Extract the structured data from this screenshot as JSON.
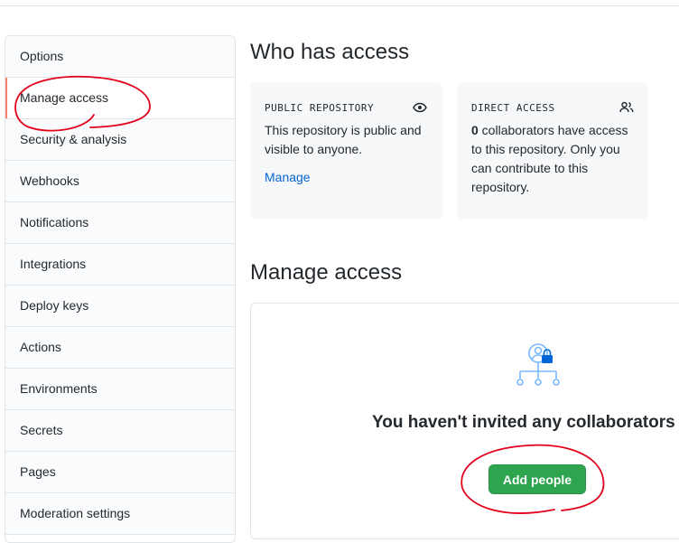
{
  "sidebar": {
    "items": [
      {
        "label": "Options"
      },
      {
        "label": "Manage access",
        "active": true
      },
      {
        "label": "Security & analysis"
      },
      {
        "label": "Webhooks"
      },
      {
        "label": "Notifications"
      },
      {
        "label": "Integrations"
      },
      {
        "label": "Deploy keys"
      },
      {
        "label": "Actions"
      },
      {
        "label": "Environments"
      },
      {
        "label": "Secrets"
      },
      {
        "label": "Pages"
      },
      {
        "label": "Moderation settings"
      }
    ]
  },
  "who_has_access": {
    "title": "Who has access",
    "public_card": {
      "title": "PUBLIC REPOSITORY",
      "icon": "eye-icon",
      "text": "This repository is public and visible to anyone.",
      "link": "Manage"
    },
    "direct_card": {
      "title": "DIRECT ACCESS",
      "icon": "people-icon",
      "count": "0",
      "text": " collaborators have access to this repository. Only you can contribute to this repository."
    }
  },
  "manage_access": {
    "title": "Manage access",
    "icon": "collaborators-lock-icon",
    "empty_message": "You haven't invited any collaborators",
    "add_button": "Add people"
  },
  "colors": {
    "accent": "#f9826c",
    "link": "#0366d6",
    "button": "#2ea44f",
    "annotation": "#e3001b"
  }
}
